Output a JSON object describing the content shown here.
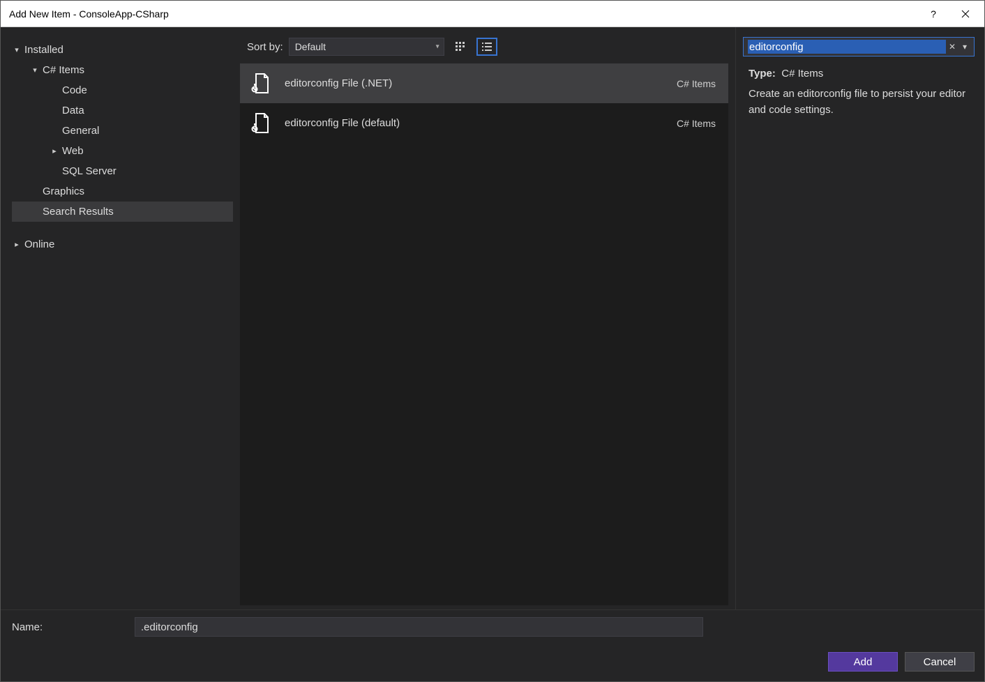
{
  "window": {
    "title": "Add New Item - ConsoleApp-CSharp"
  },
  "sidebar": {
    "items": [
      {
        "label": "Installed",
        "indent": 0,
        "arrow": "▾",
        "selected": false
      },
      {
        "label": "C# Items",
        "indent": 1,
        "arrow": "▾",
        "selected": false
      },
      {
        "label": "Code",
        "indent": 2,
        "arrow": "",
        "selected": false
      },
      {
        "label": "Data",
        "indent": 2,
        "arrow": "",
        "selected": false
      },
      {
        "label": "General",
        "indent": 2,
        "arrow": "",
        "selected": false
      },
      {
        "label": "Web",
        "indent": 2,
        "arrow": "▸",
        "selected": false
      },
      {
        "label": "SQL Server",
        "indent": 2,
        "arrow": "",
        "selected": false
      },
      {
        "label": "Graphics",
        "indent": 1,
        "arrow": "",
        "selected": false
      },
      {
        "label": "Search Results",
        "indent": 1,
        "arrow": "",
        "selected": true
      },
      {
        "label": "Online",
        "indent": 0,
        "arrow": "▸",
        "selected": false,
        "gap": true
      }
    ]
  },
  "toolbar": {
    "sort_by_label": "Sort by:",
    "sort_value": "Default"
  },
  "search": {
    "value": "editorconfig"
  },
  "templates": [
    {
      "name": "editorconfig File (.NET)",
      "category": "C# Items",
      "selected": true
    },
    {
      "name": "editorconfig File (default)",
      "category": "C# Items",
      "selected": false
    }
  ],
  "details": {
    "type_label": "Type:",
    "type_value": "C# Items",
    "description": "Create an editorconfig file to persist your editor and code settings."
  },
  "footer": {
    "name_label": "Name:",
    "name_value": ".editorconfig",
    "add_label": "Add",
    "cancel_label": "Cancel"
  }
}
